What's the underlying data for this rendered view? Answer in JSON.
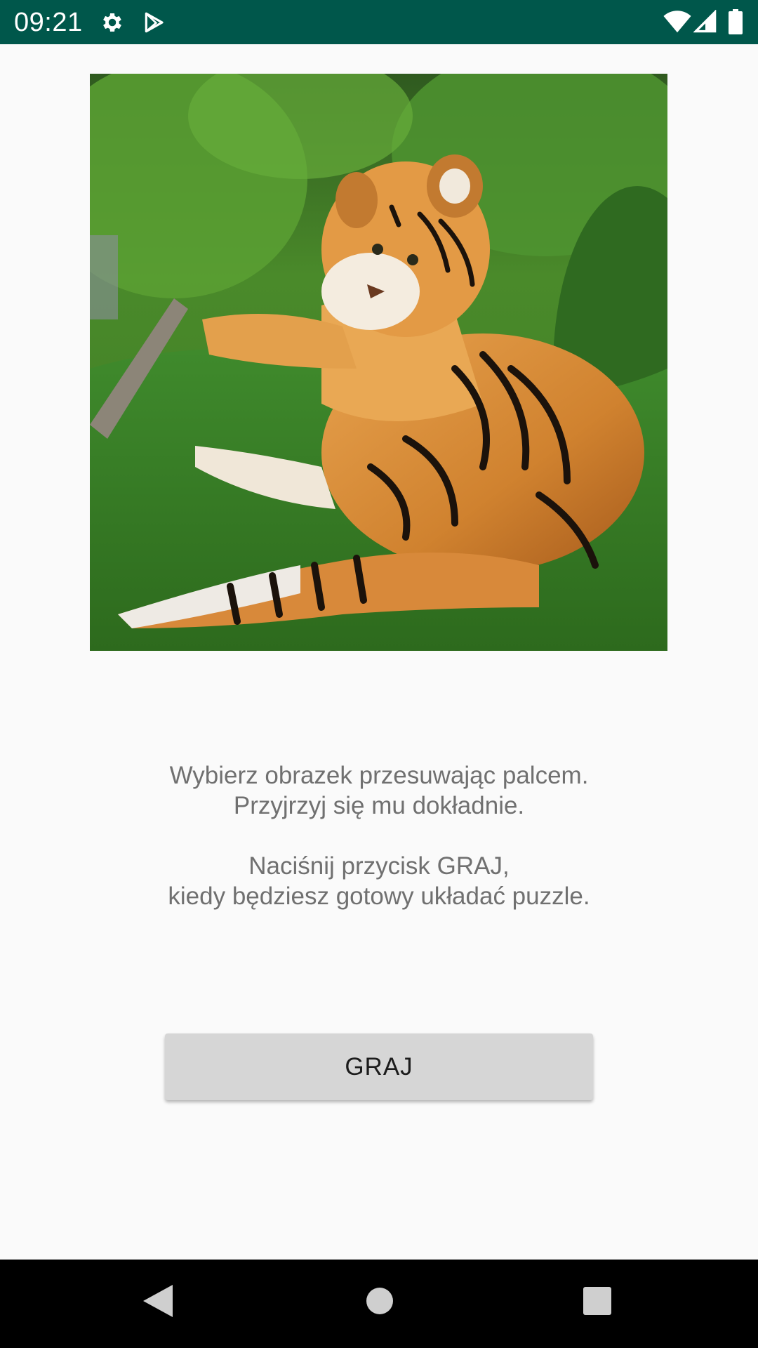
{
  "status_bar": {
    "time": "09:21",
    "icons": [
      "gear-icon",
      "play-store-icon",
      "wifi-icon",
      "cell-signal-icon",
      "battery-icon"
    ]
  },
  "image": {
    "subject": "tiger lying on grass",
    "selectable_by_swipe": true
  },
  "instructions": {
    "line1": "Wybierz obrazek przesuwając palcem.",
    "line2": "Przyjrzyj się mu dokładnie.",
    "line3": "Naciśnij przycisk GRAJ,",
    "line4": "kiedy będziesz gotowy układać puzzle."
  },
  "play_button": {
    "label": "GRAJ"
  },
  "nav_bar": {
    "icons": [
      "back-icon",
      "home-icon",
      "recents-icon"
    ]
  },
  "colors": {
    "status_bar": "#00574b",
    "background": "#fafafa",
    "button": "#d6d6d6",
    "text": "#707070"
  }
}
